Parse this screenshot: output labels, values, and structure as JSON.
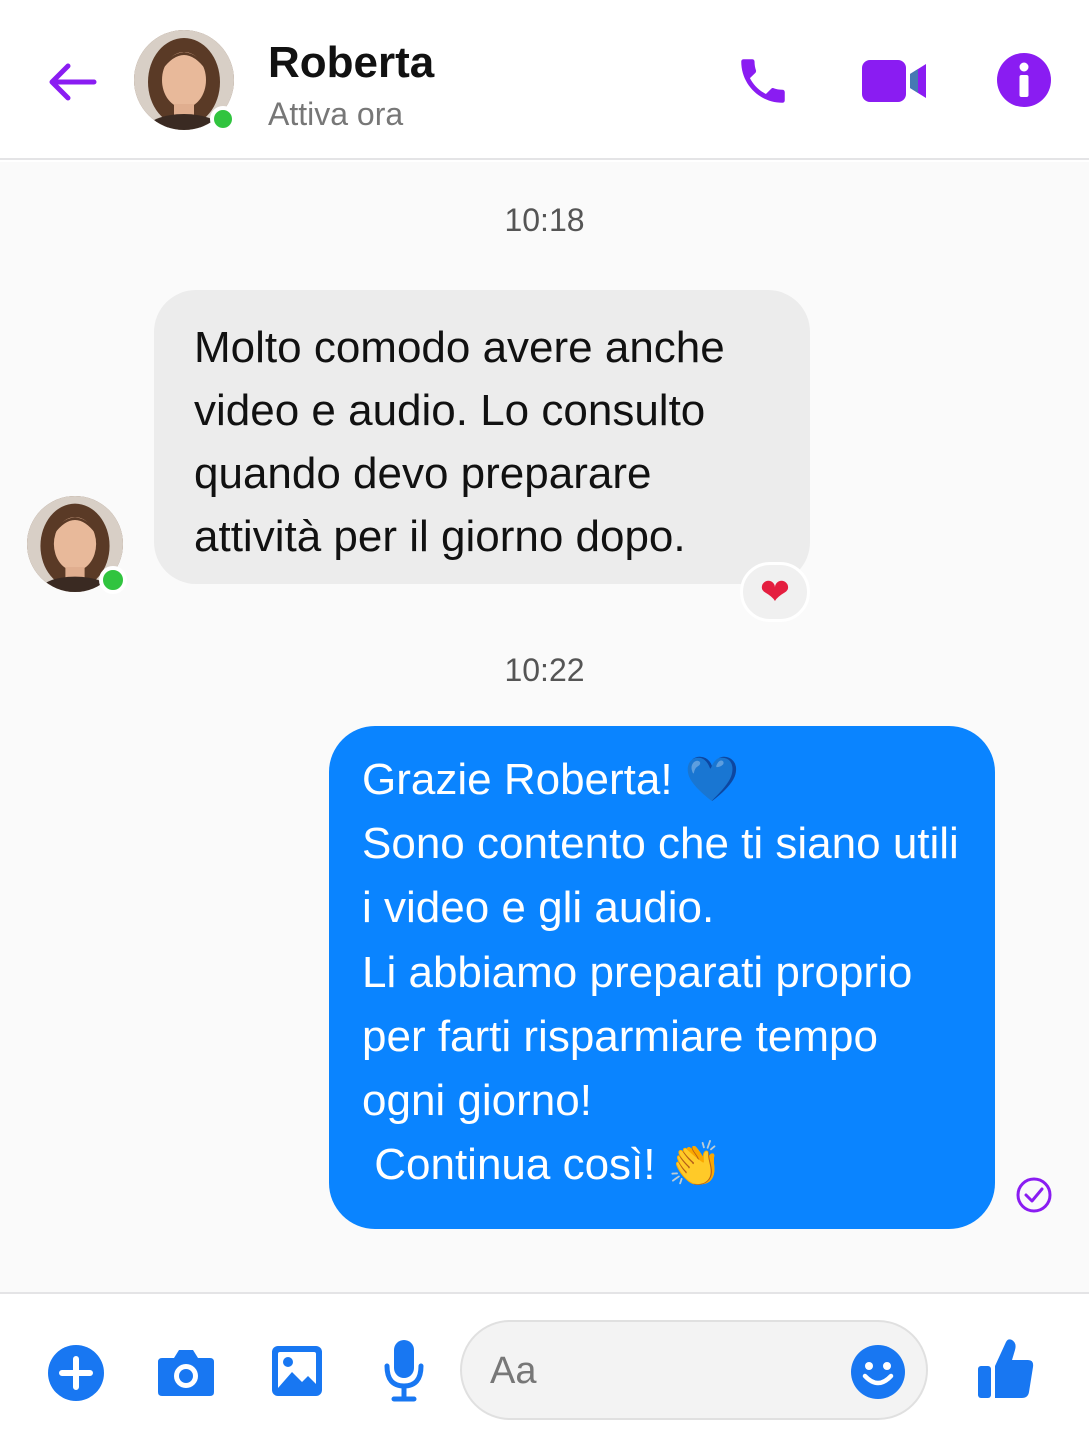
{
  "header": {
    "contact_name": "Roberta",
    "status": "Attiva ora"
  },
  "chat": {
    "timestamps": [
      "10:18",
      "10:22"
    ],
    "incoming_message": {
      "lines": [
        "Molto comodo avere anche",
        "video e audio. Lo consulto",
        "quando devo preparare",
        "attività per il giorno dopo."
      ],
      "reaction": "❤"
    },
    "outgoing_message": {
      "lines": [
        "Grazie Roberta! 💙",
        "Sono contento che ti siano utili",
        "i video e gli audio.",
        "Li abbiamo preparati proprio",
        "per farti risparmiare tempo",
        "ogni giorno!",
        " Continua così! 👏"
      ],
      "status_icon": "seen-check-icon"
    }
  },
  "composer": {
    "placeholder": "Aa"
  },
  "colors": {
    "accent_purple": "#8a1cf2",
    "outgoing_bubble": "#0a84ff",
    "incoming_bubble": "#ececec",
    "online_green": "#31c43f",
    "composer_blue": "#1877f2"
  },
  "icons": {
    "back": "back-arrow-icon",
    "call": "phone-icon",
    "video": "video-camera-icon",
    "info": "info-icon",
    "plus": "plus-icon",
    "camera": "camera-icon",
    "gallery": "image-icon",
    "mic": "microphone-icon",
    "emoji": "smiley-icon",
    "like": "thumbs-up-icon"
  }
}
